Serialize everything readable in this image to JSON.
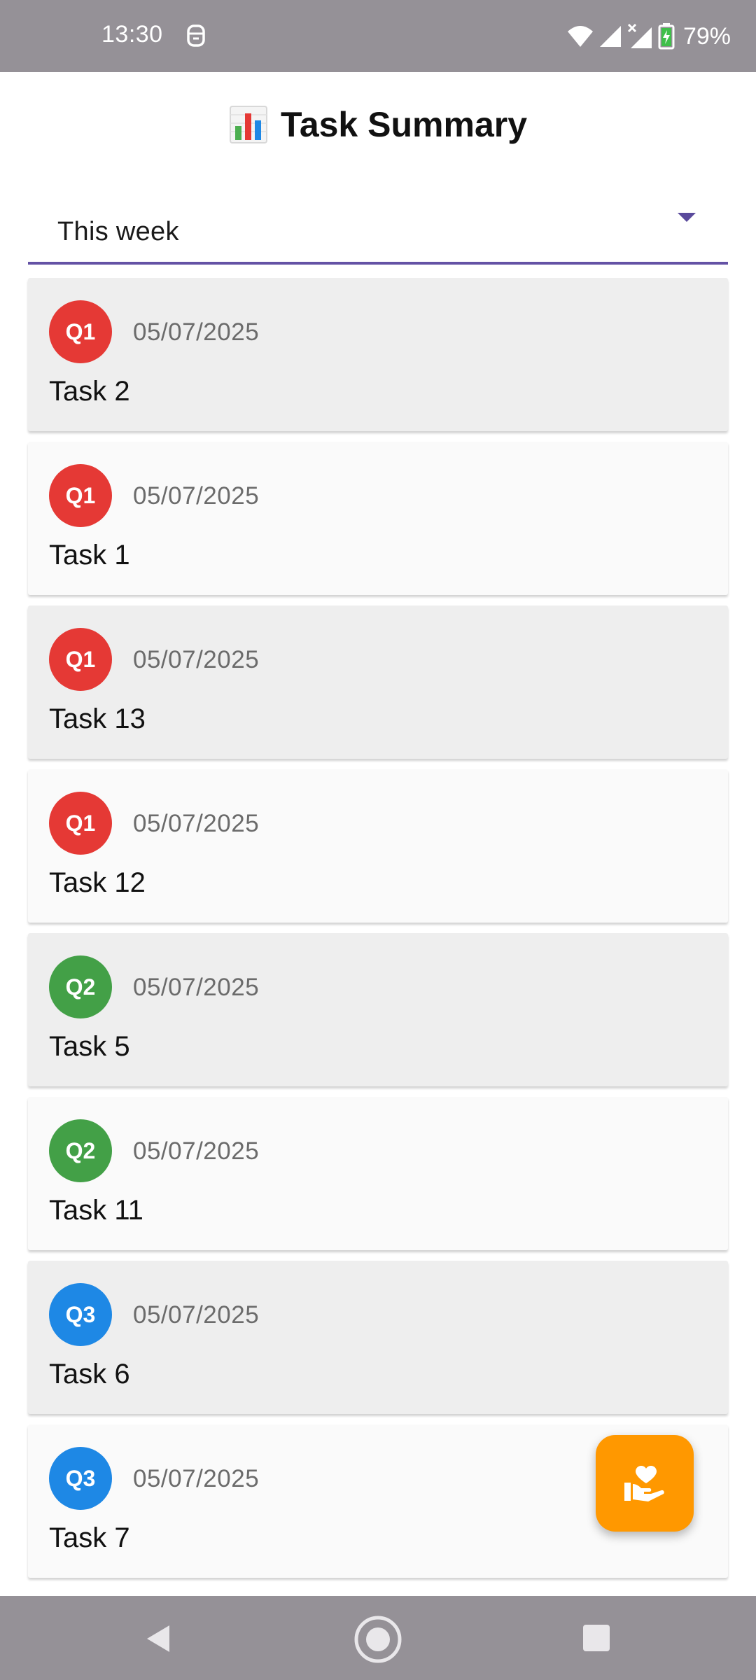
{
  "status_bar": {
    "time": "13:30",
    "battery": "79%",
    "icons": [
      "notification-icon",
      "wifi-icon",
      "signal-icon",
      "signal-no-data-icon",
      "battery-charging-icon"
    ]
  },
  "header": {
    "icon": "bar-chart-icon",
    "title": "Task Summary"
  },
  "filter": {
    "selected": "This week"
  },
  "colors": {
    "accent": "#6452a5",
    "q1": "#e53935",
    "q2": "#43a047",
    "q3": "#1e88e5",
    "fab": "#ff9800"
  },
  "tasks": [
    {
      "quadrant": "Q1",
      "date": "05/07/2025",
      "name": "Task 2"
    },
    {
      "quadrant": "Q1",
      "date": "05/07/2025",
      "name": "Task 1"
    },
    {
      "quadrant": "Q1",
      "date": "05/07/2025",
      "name": "Task 13"
    },
    {
      "quadrant": "Q1",
      "date": "05/07/2025",
      "name": "Task 12"
    },
    {
      "quadrant": "Q2",
      "date": "05/07/2025",
      "name": "Task 5"
    },
    {
      "quadrant": "Q2",
      "date": "05/07/2025",
      "name": "Task 11"
    },
    {
      "quadrant": "Q3",
      "date": "05/07/2025",
      "name": "Task 6"
    },
    {
      "quadrant": "Q3",
      "date": "05/07/2025",
      "name": "Task 7"
    }
  ],
  "fab": {
    "icon": "volunteer-heart-hand-icon"
  },
  "nav_bar": {
    "icons": [
      "back-icon",
      "home-icon",
      "recents-icon"
    ]
  }
}
